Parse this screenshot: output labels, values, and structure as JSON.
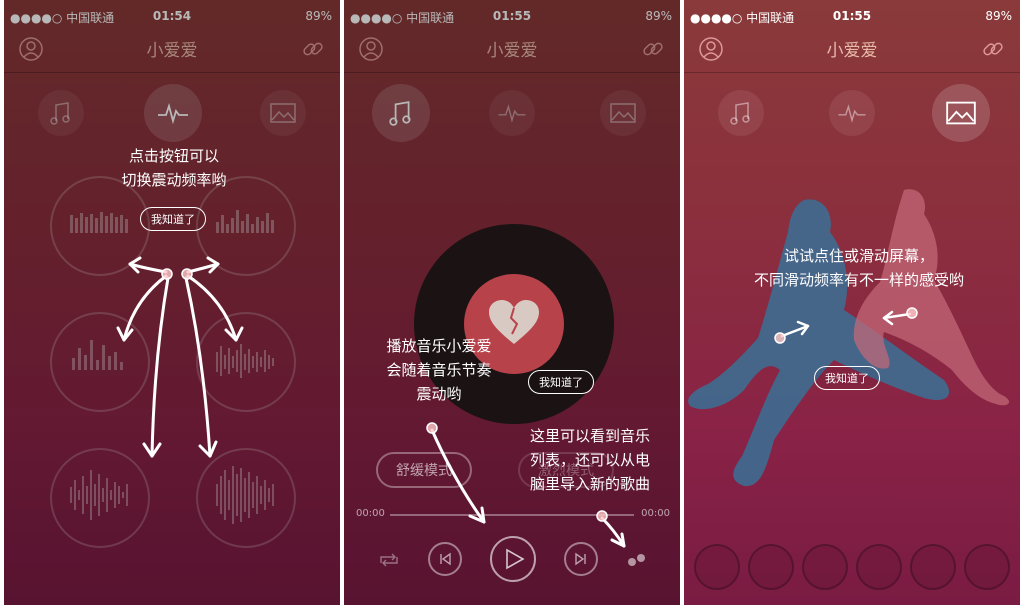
{
  "status": {
    "carrier": "●●●●○ 中国联通",
    "battery": "89%"
  },
  "screens": [
    {
      "time": "01:54",
      "title": "小爱爱",
      "hint_line1": "点击按钮可以",
      "hint_line2": "切换震动频率哟",
      "dismiss": "我知道了"
    },
    {
      "time": "01:55",
      "title": "小爱爱",
      "hint_a_line1": "播放音乐小爱爱",
      "hint_a_line2": "会随着音乐节奏",
      "hint_a_line3": "震动哟",
      "hint_b_line1": "这里可以看到音乐",
      "hint_b_line2": "列表，还可以从电",
      "hint_b_line3": "脑里导入新的歌曲",
      "dismiss": "我知道了",
      "mode_comfort": "舒缓模式",
      "mode_other": "激烈模式",
      "time_start": "00:00",
      "time_end": "00:00"
    },
    {
      "time": "01:55",
      "title": "小爱爱",
      "hint_line1": "试试点住或滑动屏幕，",
      "hint_line2": "不同滑动频率有不一样的感受哟",
      "dismiss": "我知道了"
    }
  ],
  "colors": {
    "bg_top": "#8a3a3a",
    "bg_bottom": "#7a1b43",
    "accent": "#e7b9a9"
  },
  "icons": [
    "user-icon",
    "link-icon",
    "music-icon",
    "pulse-icon",
    "image-icon",
    "heart-icon",
    "play-icon",
    "prev-icon",
    "next-icon",
    "repeat-icon"
  ]
}
